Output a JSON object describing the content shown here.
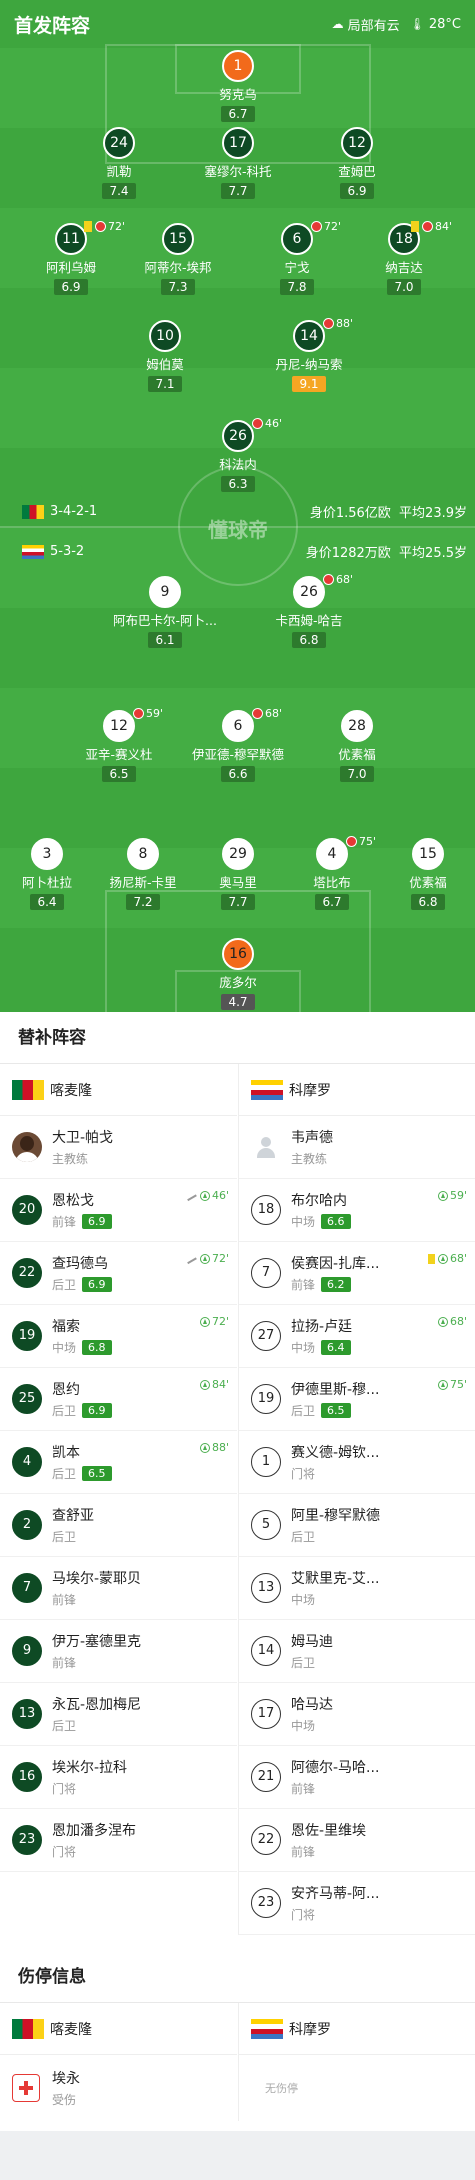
{
  "header": {
    "title": "首发阵容",
    "weather": "局部有云",
    "temperature": "28°C"
  },
  "watermark": "懂球帝",
  "home": {
    "formation": "3-4-2-1",
    "value": "身价1.56亿欧",
    "age": "平均23.9岁"
  },
  "away": {
    "formation": "5-3-2",
    "value": "身价1282万欧",
    "age": "平均25.5岁"
  },
  "pitch_players": [
    {
      "num": "1",
      "name": "努克乌",
      "rating": "6.7"
    },
    {
      "num": "24",
      "name": "凯勒",
      "rating": "7.4"
    },
    {
      "num": "17",
      "name": "塞缪尔-科托",
      "rating": "7.7"
    },
    {
      "num": "12",
      "name": "查姆巴",
      "rating": "6.9"
    },
    {
      "num": "11",
      "name": "阿利乌姆",
      "rating": "6.9",
      "minute": "72'"
    },
    {
      "num": "15",
      "name": "阿蒂尔-埃邦",
      "rating": "7.3"
    },
    {
      "num": "6",
      "name": "宁戈",
      "rating": "7.8",
      "minute": "72'"
    },
    {
      "num": "18",
      "name": "纳吉达",
      "rating": "7.0",
      "minute": "84'"
    },
    {
      "num": "10",
      "name": "姆伯莫",
      "rating": "7.1"
    },
    {
      "num": "14",
      "name": "丹尼-纳马索",
      "rating": "9.1",
      "minute": "88'"
    },
    {
      "num": "26",
      "name": "科法内",
      "rating": "6.3",
      "minute": "46'"
    },
    {
      "num": "9",
      "name": "阿布巴卡尔-阿卜...",
      "rating": "6.1"
    },
    {
      "num": "26",
      "name": "卡西姆-哈吉",
      "rating": "6.8",
      "minute": "68'"
    },
    {
      "num": "12",
      "name": "亚辛-赛义杜",
      "rating": "6.5",
      "minute": "59'"
    },
    {
      "num": "6",
      "name": "伊亚德-穆罕默德",
      "rating": "6.6",
      "minute": "68'"
    },
    {
      "num": "28",
      "name": "优素福",
      "rating": "7.0"
    },
    {
      "num": "3",
      "name": "阿卜杜拉",
      "rating": "6.4"
    },
    {
      "num": "8",
      "name": "扬尼斯-卡里",
      "rating": "7.2"
    },
    {
      "num": "29",
      "name": "奥马里",
      "rating": "7.7"
    },
    {
      "num": "4",
      "name": "塔比布",
      "rating": "6.7",
      "minute": "75'"
    },
    {
      "num": "15",
      "name": "优素福",
      "rating": "6.8"
    },
    {
      "num": "16",
      "name": "庞多尔",
      "rating": "4.7"
    }
  ],
  "subs": {
    "title": "替补阵容",
    "home_team": "喀麦隆",
    "away_team": "科摩罗",
    "home_coach": {
      "name": "大卫-帕戈",
      "role": "主教练"
    },
    "away_coach": {
      "name": "韦声德",
      "role": "主教练"
    },
    "home": [
      {
        "num": "20",
        "name": "恩松戈",
        "pos": "前锋",
        "rating": "6.9",
        "minute": "46'"
      },
      {
        "num": "22",
        "name": "查玛德乌",
        "pos": "后卫",
        "rating": "6.9",
        "minute": "72'"
      },
      {
        "num": "19",
        "name": "福索",
        "pos": "中场",
        "rating": "6.8",
        "minute": "72'"
      },
      {
        "num": "25",
        "name": "恩约",
        "pos": "后卫",
        "rating": "6.9",
        "minute": "84'"
      },
      {
        "num": "4",
        "name": "凯本",
        "pos": "后卫",
        "rating": "6.5",
        "minute": "88'"
      },
      {
        "num": "2",
        "name": "查舒亚",
        "pos": "后卫"
      },
      {
        "num": "7",
        "name": "马埃尔-蒙耶贝",
        "pos": "前锋"
      },
      {
        "num": "9",
        "name": "伊万-塞德里克",
        "pos": "前锋"
      },
      {
        "num": "13",
        "name": "永瓦-恩加梅尼",
        "pos": "后卫"
      },
      {
        "num": "16",
        "name": "埃米尔-拉科",
        "pos": "门将"
      },
      {
        "num": "23",
        "name": "恩加潘多涅布",
        "pos": "门将"
      }
    ],
    "away": [
      {
        "num": "18",
        "name": "布尔哈内",
        "pos": "中场",
        "rating": "6.6",
        "minute": "59'"
      },
      {
        "num": "7",
        "name": "侯赛因-扎库...",
        "pos": "前锋",
        "rating": "6.2",
        "minute": "68'"
      },
      {
        "num": "27",
        "name": "拉扬-卢廷",
        "pos": "中场",
        "rating": "6.4",
        "minute": "68'"
      },
      {
        "num": "19",
        "name": "伊德里斯-穆...",
        "pos": "后卫",
        "rating": "6.5",
        "minute": "75'"
      },
      {
        "num": "1",
        "name": "赛义德-姆钦...",
        "pos": "门将"
      },
      {
        "num": "5",
        "name": "阿里-穆罕默德",
        "pos": "后卫"
      },
      {
        "num": "13",
        "name": "艾默里克-艾...",
        "pos": "中场"
      },
      {
        "num": "14",
        "name": "姆马迪",
        "pos": "后卫"
      },
      {
        "num": "17",
        "name": "哈马达",
        "pos": "中场"
      },
      {
        "num": "21",
        "name": "阿德尔-马哈...",
        "pos": "前锋"
      },
      {
        "num": "22",
        "name": "恩佐-里维埃",
        "pos": "前锋"
      },
      {
        "num": "23",
        "name": "安齐马蒂-阿...",
        "pos": "门将"
      }
    ]
  },
  "injury": {
    "title": "伤停信息",
    "home_team": "喀麦隆",
    "away_team": "科摩罗",
    "home": {
      "name": "埃永",
      "status": "受伤"
    },
    "away_none": "无伤停"
  },
  "colors": {
    "pitch": "#3ea63e",
    "home_circle": "#0e4a24",
    "gk": "#f26a1b",
    "rating_high": "#f5a623"
  }
}
